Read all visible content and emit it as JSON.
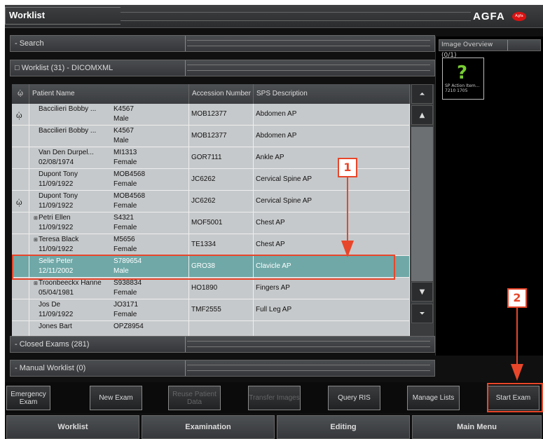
{
  "app": {
    "title": "Worklist",
    "brand": "AGFA",
    "brand_badge": "Agfa"
  },
  "sections": {
    "search": "- Search",
    "worklist": "□ Worklist (31) - DICOMXML",
    "closed": "- Closed Exams (281)",
    "manual": "- Manual Worklist (0)"
  },
  "image_overview": {
    "title": "Image Overview (0/1)",
    "thumb_line1": "SP Action Item...",
    "thumb_line2": "7210 1705",
    "thumb_glyph": "?"
  },
  "table": {
    "headers": {
      "icon": "ᾡ",
      "name": "Patient Name",
      "accession": "Accession Number",
      "sps": "SPS Description"
    },
    "rows": [
      {
        "eye": "ᾡ",
        "exp": "",
        "name": "Baccilieri  Bobby ...",
        "dob": "",
        "id": "K4567",
        "sex": "Male",
        "acc": "MOB12377",
        "sps": "Abdomen AP"
      },
      {
        "eye": "",
        "exp": "",
        "name": "Baccilieri  Bobby ...",
        "dob": "",
        "id": "K4567",
        "sex": "Male",
        "acc": "MOB12377",
        "sps": "Abdomen AP"
      },
      {
        "eye": "",
        "exp": "",
        "name": "Van Den Durpel...",
        "dob": "02/08/1974",
        "id": "MI1313",
        "sex": "Female",
        "acc": "GOR7111",
        "sps": "Ankle AP"
      },
      {
        "eye": "",
        "exp": "",
        "name": "Dupont Tony",
        "dob": "11/09/1922",
        "id": "MOB4568",
        "sex": "Female",
        "acc": "JC6262",
        "sps": "Cervical Spine AP"
      },
      {
        "eye": "ᾡ",
        "exp": "",
        "name": "Dupont Tony",
        "dob": "11/09/1922",
        "id": "MOB4568",
        "sex": "Female",
        "acc": "JC6262",
        "sps": "Cervical Spine AP"
      },
      {
        "eye": "",
        "exp": "⊞",
        "name": "Petri Ellen",
        "dob": "11/09/1922",
        "id": "S4321",
        "sex": "Female",
        "acc": "MOF5001",
        "sps": "Chest AP"
      },
      {
        "eye": "",
        "exp": "⊞",
        "name": "Teresa Black",
        "dob": "11/09/1922",
        "id": "M5656",
        "sex": "Female",
        "acc": "TE1334",
        "sps": "Chest AP"
      },
      {
        "eye": "",
        "exp": "",
        "name": "Selie Peter",
        "dob": "12/11/2002",
        "id": "S789654",
        "sex": "Male",
        "acc": "GRO38",
        "sps": "Clavicle AP"
      },
      {
        "eye": "",
        "exp": "⊞",
        "name": "Troonbeeckx Hanne",
        "dob": "05/04/1981",
        "id": "S938834",
        "sex": "Female",
        "acc": "HO1890",
        "sps": "Fingers AP"
      },
      {
        "eye": "",
        "exp": "",
        "name": "Jos De",
        "dob": "11/09/1922",
        "id": "JO3171",
        "sex": "Female",
        "acc": "TMF2555",
        "sps": "Full Leg AP"
      },
      {
        "eye": "",
        "exp": "",
        "name": "Jones Bart",
        "dob": "",
        "id": "OPZ8954",
        "sex": "",
        "acc": "",
        "sps": ""
      }
    ]
  },
  "buttons": {
    "emergency": "Emergency Exam",
    "new_exam": "New Exam",
    "reuse": "Reuse Patient Data",
    "transfer": "Transfer Images",
    "query": "Query RIS",
    "manage": "Manage Lists",
    "start": "Start Exam"
  },
  "nav": {
    "worklist": "Worklist",
    "examination": "Examination",
    "editing": "Editing",
    "main_menu": "Main Menu"
  },
  "callouts": {
    "one": "1",
    "two": "2"
  },
  "colors": {
    "selected_row": "#6fa8a7",
    "annotation": "#e8462a",
    "logo_badge": "#dd1111"
  }
}
